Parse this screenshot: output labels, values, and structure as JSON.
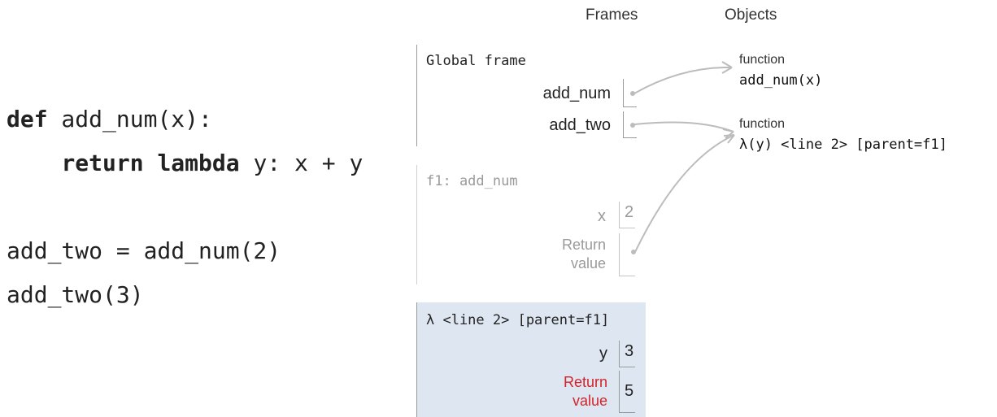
{
  "code": {
    "line1": {
      "kw": "def",
      "rest": " add_num(x):"
    },
    "line2": {
      "indent": "    ",
      "kw1": "return",
      "kw2": " lambda",
      "rest": " y: x + y"
    },
    "line4": "add_two = add_num(2)",
    "line5": "add_two(3)"
  },
  "headers": {
    "frames": "Frames",
    "objects": "Objects"
  },
  "global_frame": {
    "title": "Global frame",
    "vars": [
      {
        "name": "add_num"
      },
      {
        "name": "add_two"
      }
    ]
  },
  "f1_frame": {
    "title": "f1: add_num",
    "vars": [
      {
        "name": "x",
        "value": "2"
      },
      {
        "name": "Return\nvalue"
      }
    ]
  },
  "lambda_frame": {
    "title": "λ <line 2> [parent=f1]",
    "vars": [
      {
        "name": "y",
        "value": "3"
      },
      {
        "name": "Return\nvalue",
        "value": "5"
      }
    ]
  },
  "objects": [
    {
      "label": "function",
      "value": "add_num(x)"
    },
    {
      "label": "function",
      "value": "λ(y) <line 2> [parent=f1]"
    }
  ],
  "colors": {
    "active_frame_bg": "#dde6f1",
    "inactive_text": "#9a9a9a",
    "return_value_red": "#d3242b",
    "arrow": "#bcbcbc",
    "frame_border": "#9a9a9a"
  }
}
